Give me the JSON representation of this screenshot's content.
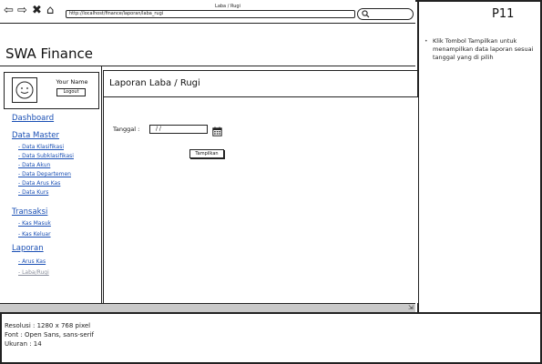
{
  "browser": {
    "page_title": "Laba / Rugi",
    "url": "http://localhost/finance/laporan/laba_rugi",
    "nav_icons": [
      "back-arrow-icon",
      "forward-arrow-icon",
      "close-icon",
      "home-icon",
      "search-icon"
    ]
  },
  "app": {
    "title": "SWA Finance"
  },
  "user": {
    "name": "Your Name",
    "logout_label": "Logout"
  },
  "sidebar": {
    "dashboard": "Dashboard",
    "data_master": {
      "label": "Data Master",
      "items": [
        "- Data Klasifikasi",
        "- Data Subklasifikasi",
        "- Data Akun",
        "- Data Departemen",
        "- Data Arus Kas",
        "- Data Kurs"
      ]
    },
    "transaksi": {
      "label": "Transaksi",
      "items": [
        "- Kas Masuk",
        "- Kas Keluar"
      ]
    },
    "laporan": {
      "label": "Laporan",
      "items": [
        "- Arus Kas",
        "- Laba/Rugi"
      ]
    }
  },
  "content": {
    "title": "Laporan Laba / Rugi",
    "date_label": "Tanggal :",
    "date_value": "/ /",
    "show_button": "Tampilkan"
  },
  "notes": {
    "panel_code": "P11",
    "bullet": "•",
    "text": "Klik Tombol Tampilkan untuk menampilkan data laporan sesuai tanggal yang di pilih"
  },
  "footer": {
    "resolution": "Resolusi : 1280 x 768 pixel",
    "font": "Font : Open Sans, sans-serif",
    "size": "Ukuran : 14"
  },
  "colors": {
    "link": "#1a4fb4",
    "muted_link": "#8a8f9c",
    "status_bar": "#c9c9c9"
  }
}
